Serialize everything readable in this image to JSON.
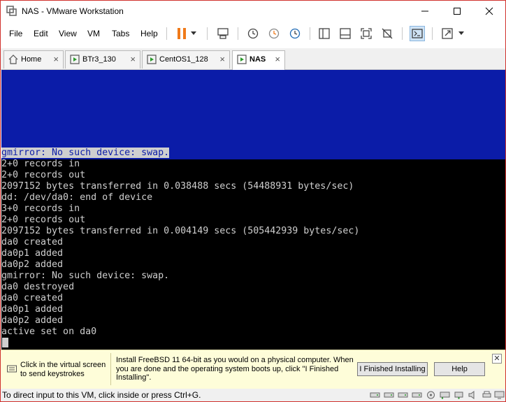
{
  "window": {
    "title": "NAS - VMware Workstation",
    "controls": [
      "minimize",
      "maximize",
      "close"
    ]
  },
  "menu": {
    "items": [
      "File",
      "Edit",
      "View",
      "VM",
      "Tabs",
      "Help"
    ]
  },
  "toolbar": {
    "icons": [
      "pause-icon",
      "dropdown-icon",
      "send-ctrl-alt-del-icon",
      "snapshot-take-icon",
      "snapshot-revert-icon",
      "snapshot-manager-icon",
      "library-view-icon",
      "thumbnail-bar-icon",
      "full-screen-icon",
      "unity-icon",
      "console-view-icon",
      "stretch-icon",
      "dropdown-icon"
    ]
  },
  "tabs": [
    {
      "label": "Home",
      "icon": "home-icon",
      "active": false
    },
    {
      "label": "BTr3_130",
      "icon": "vm-icon",
      "active": false
    },
    {
      "label": "CentOS1_128",
      "icon": "vm-icon",
      "active": false
    },
    {
      "label": "NAS",
      "icon": "vm-icon",
      "active": true
    }
  ],
  "console": {
    "highlighted_line": "gmirror: No such device: swap.",
    "lines": [
      "2+0 records in",
      "2+0 records out",
      "2097152 bytes transferred in 0.038488 secs (54488931 bytes/sec)",
      "dd: /dev/da0: end of device",
      "3+0 records in",
      "2+0 records out",
      "2097152 bytes transferred in 0.004149 secs (505442939 bytes/sec)",
      "da0 created",
      "da0p1 added",
      "da0p2 added",
      "gmirror: No such device: swap.",
      "da0 destroyed",
      "da0 created",
      "da0p1 added",
      "da0p2 added",
      "active set on da0"
    ],
    "colors": {
      "blue": "#0b1ca8",
      "text": "#cfcfcf",
      "background": "#000000"
    }
  },
  "hint": {
    "left_text": "Click in the virtual screen to send keystrokes",
    "message": "Install FreeBSD 11 64-bit as you would on a physical computer. When you are done and the operating system boots up, click \"I Finished Installing\".",
    "finished_button": "I Finished Installing",
    "help_button": "Help"
  },
  "status": {
    "text": "To direct input to this VM, click inside or press Ctrl+G.",
    "device_icons": [
      "hard-disk-icon",
      "hard-disk-icon",
      "hard-disk-icon",
      "hard-disk-icon",
      "cd-rom-icon",
      "network-icon",
      "usb-icon",
      "sound-icon",
      "printer-icon",
      "display-icon"
    ]
  }
}
